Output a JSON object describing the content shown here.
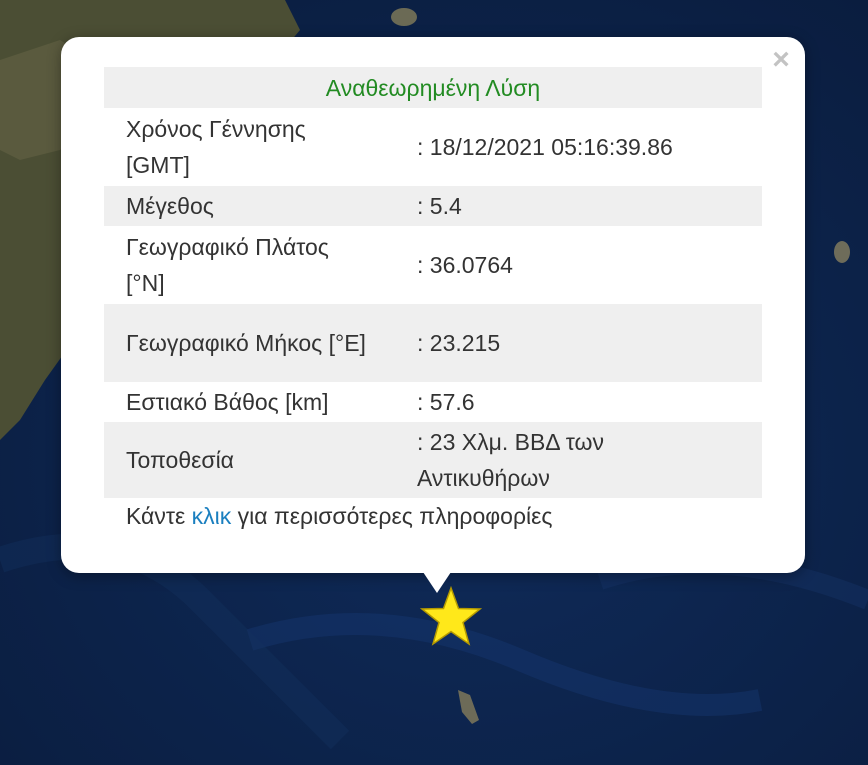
{
  "popup": {
    "title": "Αναθεωρημένη Λύση",
    "close_symbol": "×",
    "rows": [
      {
        "label": "Χρόνος Γέννησης [GMT]",
        "value": ": 18/12/2021 05:16:39.86"
      },
      {
        "label": "Μέγεθος",
        "value": ": 5.4"
      },
      {
        "label": "Γεωγραφικό Πλάτος [°N]",
        "value": ": 36.0764"
      },
      {
        "label": "Γεωγραφικό Μήκος [°E]",
        "value": ": 23.215"
      },
      {
        "label": "Εστιακό Βάθος [km]",
        "value": ": 57.6"
      },
      {
        "label": "Τοποθεσία",
        "value": ": 23 Χλμ. ΒΒΔ των Αντικυθήρων"
      }
    ],
    "footer_pre": "Κάντε ",
    "footer_link": "κλικ",
    "footer_post": " για περισσότερες πληροφορίες"
  },
  "marker": {
    "icon": "star-icon",
    "color": "#ffe81a"
  },
  "colors": {
    "sea": "#0d2248",
    "land": "#4a4d33",
    "header_text": "#228b22",
    "link": "#1a7fbf"
  }
}
